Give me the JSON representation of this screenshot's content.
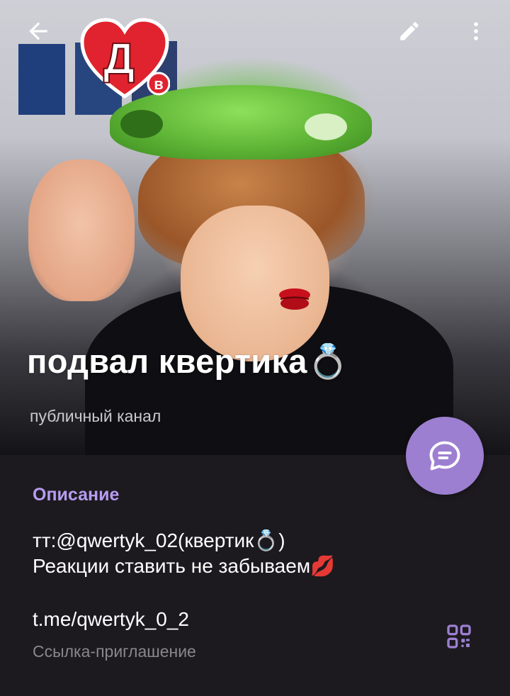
{
  "channel": {
    "name": "подвал квертика💍",
    "subtitle": "публичный канал"
  },
  "toolbar": {
    "back_icon": "arrow-left-icon",
    "edit_icon": "pencil-icon",
    "more_icon": "more-vertical-icon"
  },
  "header_sticker": {
    "letters": "Дв"
  },
  "description": {
    "label": "Описание",
    "line1": "тт:@qwertyk_02(квертик💍)",
    "line2": "Реакции ставить не забываем💋"
  },
  "invite": {
    "link": "t.me/qwertyk_0_2",
    "label": "Ссылка-приглашение",
    "qr_icon": "qr-code-icon"
  },
  "fab": {
    "icon": "chat-bubble-icon"
  },
  "colors": {
    "accent": "#9d7fd1",
    "label": "#b79cf0",
    "background": "#1c1a1f",
    "secondary_text": "#88878d"
  }
}
